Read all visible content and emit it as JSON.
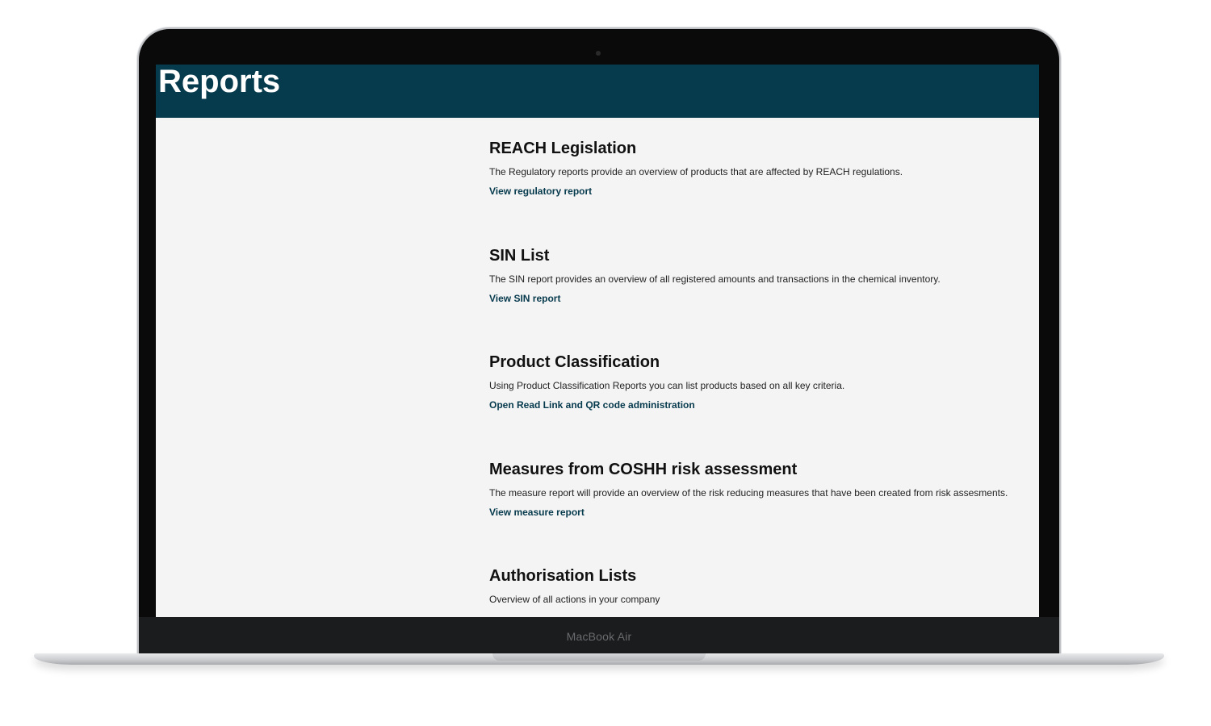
{
  "device": {
    "brand_label": "MacBook Air"
  },
  "header": {
    "title": "Reports",
    "background_color": "#063a4d"
  },
  "sections": [
    {
      "title": "REACH Legislation",
      "description": "The Regulatory reports provide an overview of products that are affected by REACH regulations.",
      "link": "View regulatory report"
    },
    {
      "title": "SIN List",
      "description": "The SIN report provides an overview of all registered amounts and transactions in the chemical inventory.",
      "link": "View SIN report"
    },
    {
      "title": "Product Classification",
      "description": "Using Product Classification Reports you can list products based on all key criteria.",
      "link": "Open Read Link and QR code administration"
    },
    {
      "title": "Measures from COSHH risk assessment",
      "description": "The measure report will provide an overview of the risk reducing measures that have been created from risk assesments.",
      "link": "View measure report"
    },
    {
      "title": "Authorisation Lists",
      "description": "Overview of all actions in your company"
    }
  ]
}
